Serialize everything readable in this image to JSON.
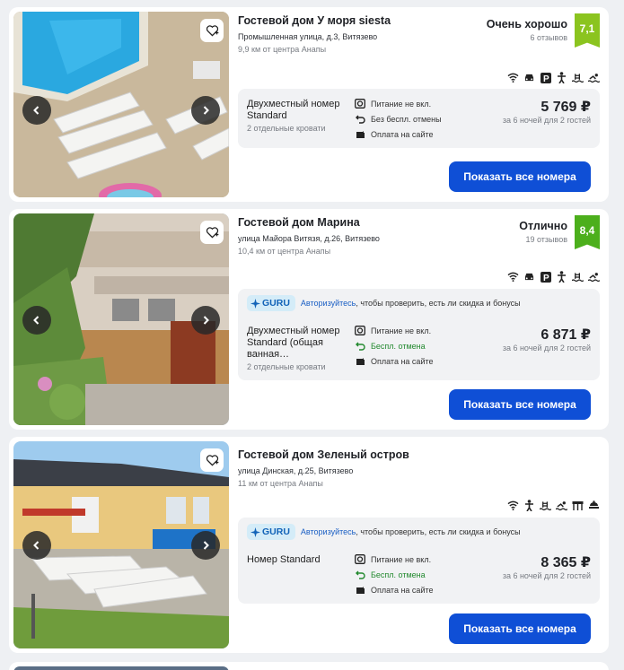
{
  "listings": [
    {
      "name": "Гостевой дом У моря siesta",
      "address": "Промышленная улица, д.3, Витязево",
      "distance": "9,9 км от центра Анапы",
      "rating_label": "Очень хорошо",
      "reviews": "6 отзывов",
      "score": "7,1",
      "score_color": "#8bc41f",
      "amenities": [
        "wifi-icon",
        "car-icon",
        "parking-icon",
        "child-icon",
        "pool-icon",
        "swim-icon"
      ],
      "room": "Двухместный номер Standard",
      "beds": "2 отдельные кровати",
      "meal": "Питание не вкл.",
      "cancel": "Без беспл. отмены",
      "payment": "Оплата на сайте",
      "price": "5 769 ₽",
      "price_note": "за 6 ночей для 2 гостей",
      "button": "Показать все номера"
    },
    {
      "name": "Гостевой дом Марина",
      "address": "улица Майора Витязя, д.26, Витязево",
      "distance": "10,4 км от центра Анапы",
      "rating_label": "Отлично",
      "reviews": "19 отзывов",
      "score": "8,4",
      "score_color": "#4caf1c",
      "amenities": [
        "wifi-icon",
        "car-icon",
        "parking-icon",
        "child-icon",
        "pool-icon",
        "swim-icon"
      ],
      "guru_badge": "GURU",
      "guru_link": "Авторизуйтесь",
      "guru_text": ", чтобы проверить, есть ли скидка и бонусы",
      "room": "Двухместный номер Standard (общая ванная…",
      "beds": "2 отдельные кровати",
      "meal": "Питание не вкл.",
      "cancel": "Беспл. отмена",
      "payment": "Оплата на сайте",
      "price": "6 871 ₽",
      "price_note": "за 6 ночей для 2 гостей",
      "button": "Показать все номера"
    },
    {
      "name": "Гостевой дом Зеленый остров",
      "address": "улица Динская, д.25, Витязево",
      "distance": "11 км от центра Анапы",
      "amenities": [
        "wifi-icon",
        "child-icon",
        "pool-icon",
        "swim-icon",
        "restaurant-icon",
        "kitchen-icon"
      ],
      "guru_badge": "GURU",
      "guru_link": "Авторизуйтесь",
      "guru_text": ", чтобы проверить, есть ли скидка и бонусы",
      "room": "Номер Standard",
      "meal": "Питание не вкл.",
      "cancel": "Беспл. отмена",
      "payment": "Оплата на сайте",
      "price": "8 365 ₽",
      "price_note": "за 6 ночей для 2 гостей",
      "button": "Показать все номера"
    }
  ],
  "colors": {
    "button": "#0f4fd6",
    "free_cancel": "#22892e",
    "guru_bg": "#d4ecf8"
  }
}
